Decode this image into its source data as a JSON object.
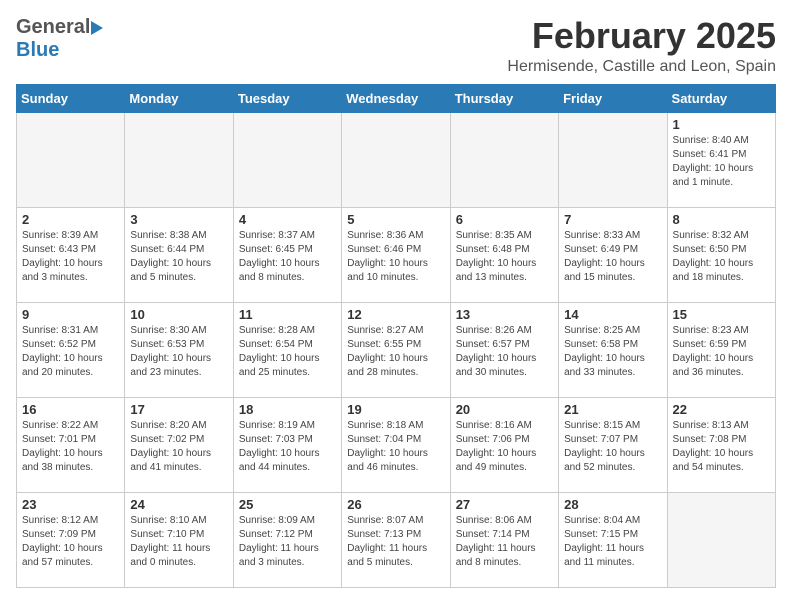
{
  "header": {
    "logo_general": "General",
    "logo_blue": "Blue",
    "month": "February 2025",
    "location": "Hermisende, Castille and Leon, Spain"
  },
  "weekdays": [
    "Sunday",
    "Monday",
    "Tuesday",
    "Wednesday",
    "Thursday",
    "Friday",
    "Saturday"
  ],
  "weeks": [
    [
      {
        "day": "",
        "info": ""
      },
      {
        "day": "",
        "info": ""
      },
      {
        "day": "",
        "info": ""
      },
      {
        "day": "",
        "info": ""
      },
      {
        "day": "",
        "info": ""
      },
      {
        "day": "",
        "info": ""
      },
      {
        "day": "1",
        "info": "Sunrise: 8:40 AM\nSunset: 6:41 PM\nDaylight: 10 hours\nand 1 minute."
      }
    ],
    [
      {
        "day": "2",
        "info": "Sunrise: 8:39 AM\nSunset: 6:43 PM\nDaylight: 10 hours\nand 3 minutes."
      },
      {
        "day": "3",
        "info": "Sunrise: 8:38 AM\nSunset: 6:44 PM\nDaylight: 10 hours\nand 5 minutes."
      },
      {
        "day": "4",
        "info": "Sunrise: 8:37 AM\nSunset: 6:45 PM\nDaylight: 10 hours\nand 8 minutes."
      },
      {
        "day": "5",
        "info": "Sunrise: 8:36 AM\nSunset: 6:46 PM\nDaylight: 10 hours\nand 10 minutes."
      },
      {
        "day": "6",
        "info": "Sunrise: 8:35 AM\nSunset: 6:48 PM\nDaylight: 10 hours\nand 13 minutes."
      },
      {
        "day": "7",
        "info": "Sunrise: 8:33 AM\nSunset: 6:49 PM\nDaylight: 10 hours\nand 15 minutes."
      },
      {
        "day": "8",
        "info": "Sunrise: 8:32 AM\nSunset: 6:50 PM\nDaylight: 10 hours\nand 18 minutes."
      }
    ],
    [
      {
        "day": "9",
        "info": "Sunrise: 8:31 AM\nSunset: 6:52 PM\nDaylight: 10 hours\nand 20 minutes."
      },
      {
        "day": "10",
        "info": "Sunrise: 8:30 AM\nSunset: 6:53 PM\nDaylight: 10 hours\nand 23 minutes."
      },
      {
        "day": "11",
        "info": "Sunrise: 8:28 AM\nSunset: 6:54 PM\nDaylight: 10 hours\nand 25 minutes."
      },
      {
        "day": "12",
        "info": "Sunrise: 8:27 AM\nSunset: 6:55 PM\nDaylight: 10 hours\nand 28 minutes."
      },
      {
        "day": "13",
        "info": "Sunrise: 8:26 AM\nSunset: 6:57 PM\nDaylight: 10 hours\nand 30 minutes."
      },
      {
        "day": "14",
        "info": "Sunrise: 8:25 AM\nSunset: 6:58 PM\nDaylight: 10 hours\nand 33 minutes."
      },
      {
        "day": "15",
        "info": "Sunrise: 8:23 AM\nSunset: 6:59 PM\nDaylight: 10 hours\nand 36 minutes."
      }
    ],
    [
      {
        "day": "16",
        "info": "Sunrise: 8:22 AM\nSunset: 7:01 PM\nDaylight: 10 hours\nand 38 minutes."
      },
      {
        "day": "17",
        "info": "Sunrise: 8:20 AM\nSunset: 7:02 PM\nDaylight: 10 hours\nand 41 minutes."
      },
      {
        "day": "18",
        "info": "Sunrise: 8:19 AM\nSunset: 7:03 PM\nDaylight: 10 hours\nand 44 minutes."
      },
      {
        "day": "19",
        "info": "Sunrise: 8:18 AM\nSunset: 7:04 PM\nDaylight: 10 hours\nand 46 minutes."
      },
      {
        "day": "20",
        "info": "Sunrise: 8:16 AM\nSunset: 7:06 PM\nDaylight: 10 hours\nand 49 minutes."
      },
      {
        "day": "21",
        "info": "Sunrise: 8:15 AM\nSunset: 7:07 PM\nDaylight: 10 hours\nand 52 minutes."
      },
      {
        "day": "22",
        "info": "Sunrise: 8:13 AM\nSunset: 7:08 PM\nDaylight: 10 hours\nand 54 minutes."
      }
    ],
    [
      {
        "day": "23",
        "info": "Sunrise: 8:12 AM\nSunset: 7:09 PM\nDaylight: 10 hours\nand 57 minutes."
      },
      {
        "day": "24",
        "info": "Sunrise: 8:10 AM\nSunset: 7:10 PM\nDaylight: 11 hours\nand 0 minutes."
      },
      {
        "day": "25",
        "info": "Sunrise: 8:09 AM\nSunset: 7:12 PM\nDaylight: 11 hours\nand 3 minutes."
      },
      {
        "day": "26",
        "info": "Sunrise: 8:07 AM\nSunset: 7:13 PM\nDaylight: 11 hours\nand 5 minutes."
      },
      {
        "day": "27",
        "info": "Sunrise: 8:06 AM\nSunset: 7:14 PM\nDaylight: 11 hours\nand 8 minutes."
      },
      {
        "day": "28",
        "info": "Sunrise: 8:04 AM\nSunset: 7:15 PM\nDaylight: 11 hours\nand 11 minutes."
      },
      {
        "day": "",
        "info": ""
      }
    ]
  ]
}
